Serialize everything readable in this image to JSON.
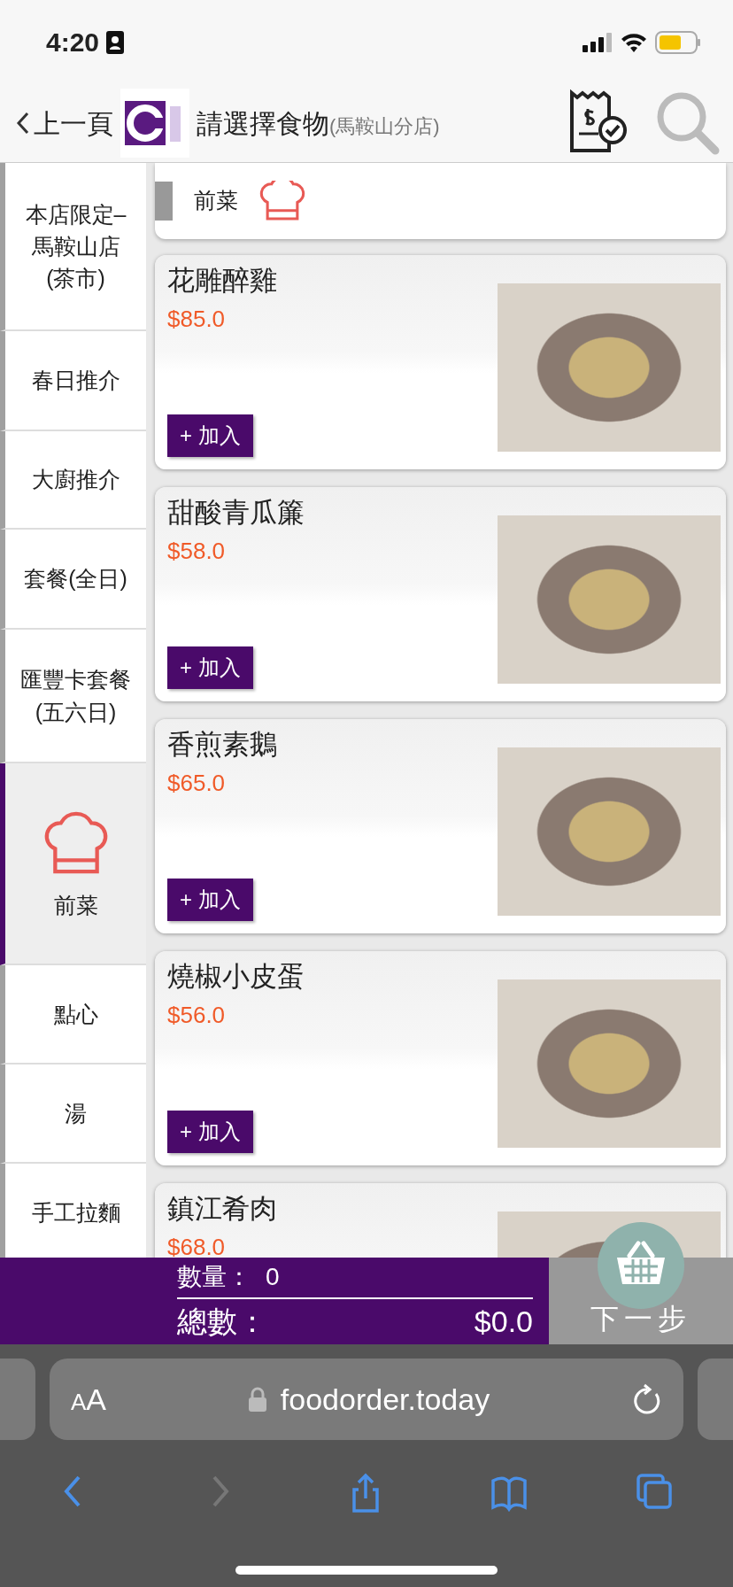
{
  "status_bar": {
    "time": "4:20"
  },
  "header": {
    "back_label": "上一頁",
    "title": "請選擇食物",
    "subtitle": "(馬鞍山分店)"
  },
  "sidebar": {
    "items": [
      {
        "label": "本店限定–馬鞍山店(茶市)",
        "selected": false
      },
      {
        "label": "春日推介",
        "selected": false
      },
      {
        "label": "大廚推介",
        "selected": false
      },
      {
        "label": "套餐(全日)",
        "selected": false
      },
      {
        "label": "匯豐卡套餐(五六日)",
        "selected": false
      },
      {
        "label": "前菜",
        "selected": true
      },
      {
        "label": "點心",
        "selected": false
      },
      {
        "label": "湯",
        "selected": false
      },
      {
        "label": "手工拉麵",
        "selected": false
      }
    ]
  },
  "category": {
    "title": "前菜"
  },
  "dishes": [
    {
      "name": "花雕醉雞",
      "price": "$85.0",
      "button": "+ 加入"
    },
    {
      "name": "甜酸青瓜簾",
      "price": "$58.0",
      "button": "+ 加入"
    },
    {
      "name": "香煎素鵝",
      "price": "$65.0",
      "button": "+ 加入"
    },
    {
      "name": "燒椒小皮蛋",
      "price": "$56.0",
      "button": "+ 加入"
    },
    {
      "name": "鎮江肴肉",
      "price": "$68.0"
    }
  ],
  "order_bar": {
    "quantity_label": "數量：",
    "quantity": "0",
    "total_label": "總數：",
    "total": "$0.0",
    "next_label": "下一步"
  },
  "browser": {
    "text_size_label": "AA",
    "url": "foodorder.today",
    "toolbar": [
      {
        "kind": "back",
        "disabled": false
      },
      {
        "kind": "forward",
        "disabled": true
      },
      {
        "kind": "share",
        "disabled": false
      },
      {
        "kind": "bookmarks",
        "disabled": false
      },
      {
        "kind": "tabs",
        "disabled": false
      }
    ]
  }
}
